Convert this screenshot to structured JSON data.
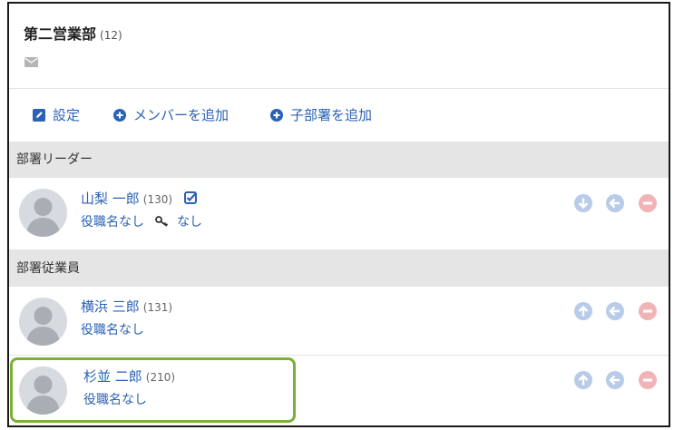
{
  "department": {
    "name": "第二営業部",
    "count": "(12)",
    "icon": "envelope-icon"
  },
  "actions": {
    "settings_label": "設定",
    "add_member_label": "メンバーを追加",
    "add_subdept_label": "子部署を追加"
  },
  "sections": {
    "leaders_label": "部署リーダー",
    "employees_label": "部署従業員"
  },
  "leader": {
    "name": "山梨 一郎",
    "id": "(130)",
    "role": "役職名なし",
    "key_value": "なし"
  },
  "employees": [
    {
      "name": "横浜 三郎",
      "id": "(131)",
      "role": "役職名なし"
    },
    {
      "name": "杉並 二郎",
      "id": "(210)",
      "role": "役職名なし"
    }
  ],
  "colors": {
    "link": "#2a62b5",
    "section_bg": "#e5e5e6",
    "action_icon_blue": "#b8cbe8",
    "remove_icon_red": "#f0b4b6",
    "highlight_green": "#7bb03a"
  }
}
